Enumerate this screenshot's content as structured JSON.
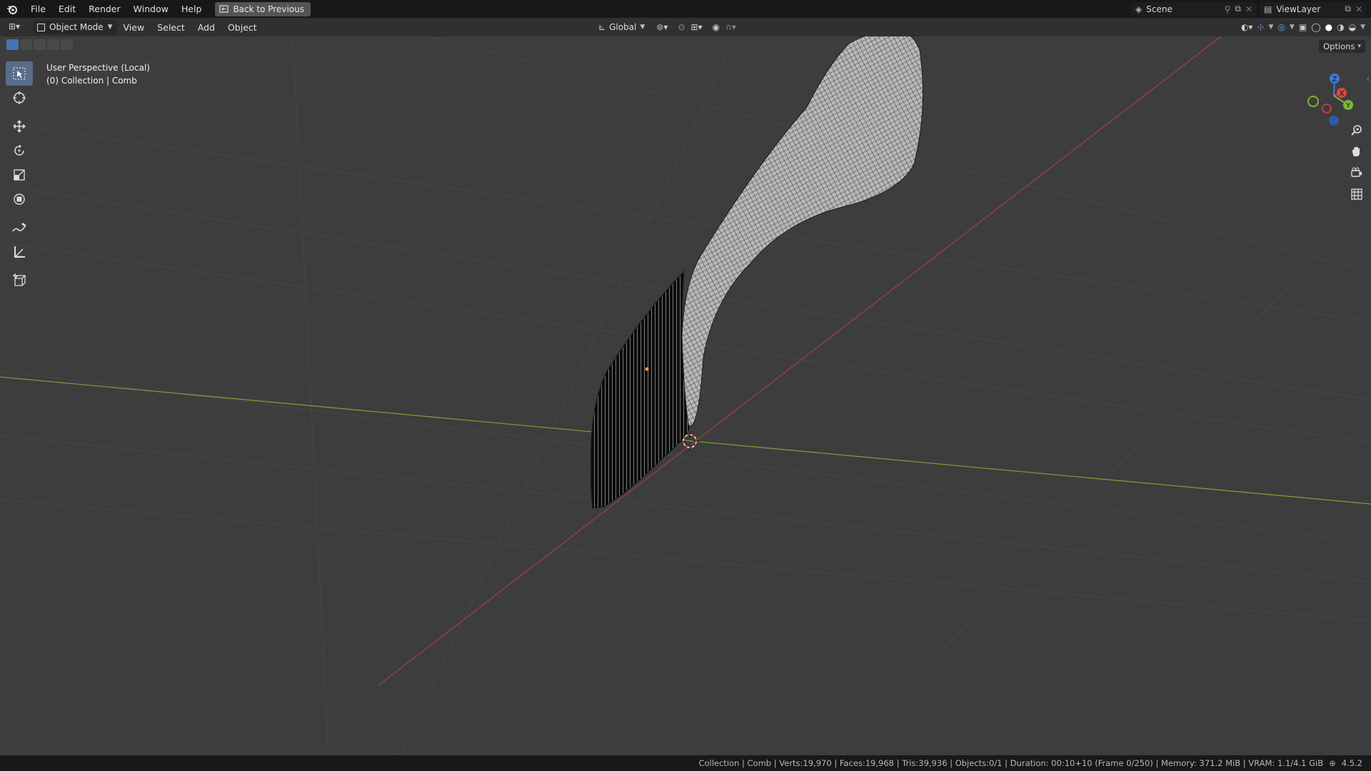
{
  "menu": {
    "file": "File",
    "edit": "Edit",
    "render": "Render",
    "window": "Window",
    "help": "Help",
    "back_button": "Back to Previous"
  },
  "topbar_right": {
    "scene": "Scene",
    "view_layer": "ViewLayer"
  },
  "header": {
    "mode": "Object Mode",
    "view": "View",
    "select": "Select",
    "add": "Add",
    "object": "Object",
    "transform_orientation": "Global"
  },
  "viewport": {
    "perspective": "User Perspective (Local)",
    "collection": "(0) Collection | Comb",
    "options": "Options"
  },
  "gizmo": {
    "x": "X",
    "y": "Y",
    "z": "Z"
  },
  "statusbar": {
    "info": "Collection | Comb | Verts:19,970 | Faces:19,968 | Tris:39,936 | Objects:0/1 | Duration: 00:10+10 (Frame 0/250) | Memory: 371.2 MiB | VRAM: 1.1/4.1 GiB",
    "version": "4.5.2"
  },
  "colors": {
    "x_axis": "#b04545",
    "y_axis": "#7a9a3a",
    "active_tool": "#5a6d8c",
    "header_bg": "#181818"
  }
}
